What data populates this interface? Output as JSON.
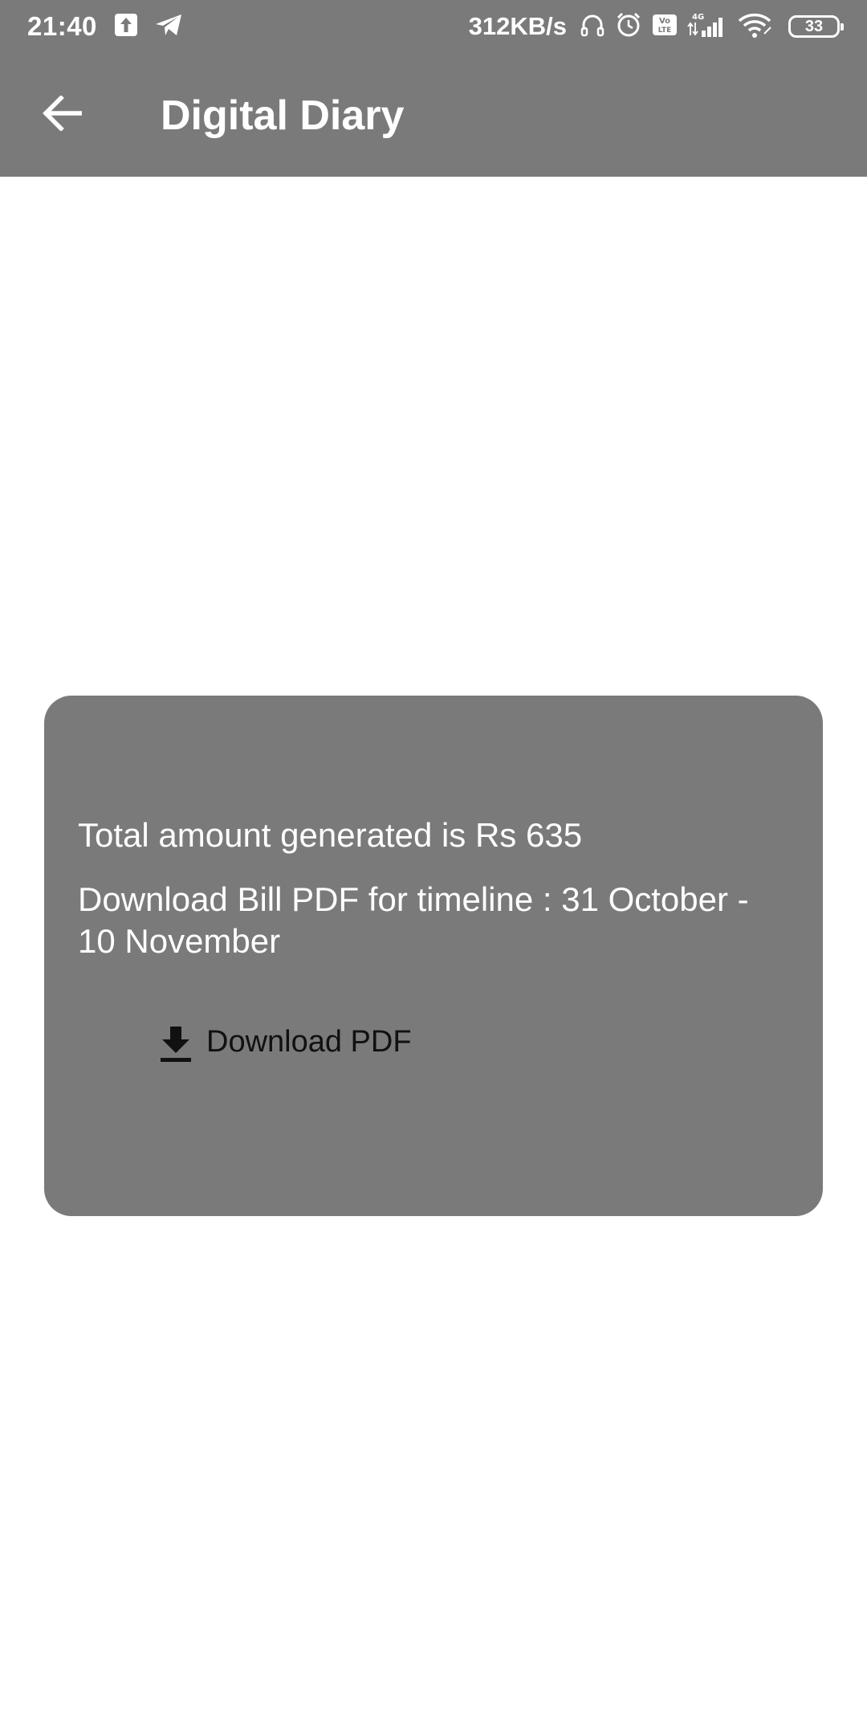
{
  "status_bar": {
    "time": "21:40",
    "net_speed": "312KB/s",
    "network_type": "4G",
    "volte_label": "Vo LTE",
    "battery": "33",
    "left_icons": [
      "upload-icon",
      "telegram-icon"
    ],
    "right_icons": [
      "headphones-icon",
      "alarm-icon",
      "volte-icon",
      "signal-icon",
      "wifi-icon",
      "battery-icon"
    ]
  },
  "app_bar": {
    "title": "Digital Diary",
    "back_icon": "arrow-back-icon"
  },
  "card": {
    "total_text": "Total amount generated is Rs 635",
    "timeline_text": "Download Bill PDF for timeline : 31 October - 10 November",
    "download_label": "Download PDF",
    "download_icon": "download-icon"
  },
  "colors": {
    "header_bg": "#7a7a7a",
    "card_bg": "#7a7a7a",
    "page_bg": "#ffffff",
    "text_on_gray": "#ffffff",
    "button_text": "#111111"
  }
}
